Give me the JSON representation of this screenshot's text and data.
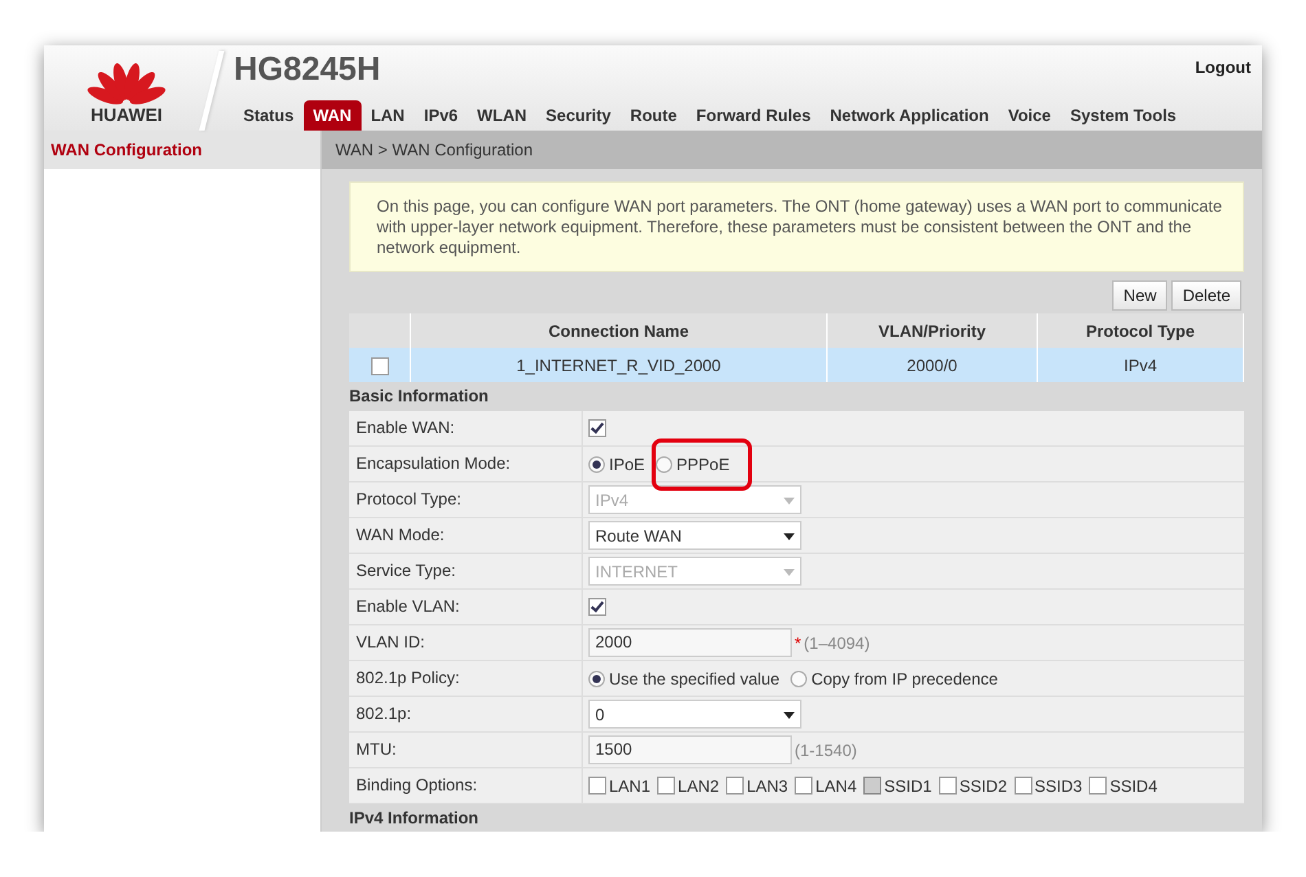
{
  "header": {
    "logo_text": "HUAWEI",
    "model": "HG8245H",
    "logout": "Logout",
    "nav": [
      {
        "label": "Status",
        "selected": false
      },
      {
        "label": "WAN",
        "selected": true
      },
      {
        "label": "LAN",
        "selected": false
      },
      {
        "label": "IPv6",
        "selected": false
      },
      {
        "label": "WLAN",
        "selected": false
      },
      {
        "label": "Security",
        "selected": false
      },
      {
        "label": "Route",
        "selected": false
      },
      {
        "label": "Forward Rules",
        "selected": false
      },
      {
        "label": "Network Application",
        "selected": false
      },
      {
        "label": "Voice",
        "selected": false
      },
      {
        "label": "System Tools",
        "selected": false
      }
    ]
  },
  "sidebar": {
    "items": [
      {
        "label": "WAN Configuration",
        "selected": true
      }
    ]
  },
  "breadcrumb": "WAN > WAN Configuration",
  "notice": "On this page, you can configure WAN port parameters. The ONT (home gateway) uses a WAN port to communicate with upper-layer network equipment. Therefore, these parameters must be consistent between the ONT and the network equipment.",
  "buttons": [
    "New",
    "Delete"
  ],
  "table": {
    "columns": [
      "Connection Name",
      "VLAN/Priority",
      "Protocol Type"
    ],
    "rows": [
      {
        "checked": false,
        "selected": true,
        "cells": [
          "1_INTERNET_R_VID_2000",
          "2000/0",
          "IPv4"
        ]
      }
    ]
  },
  "sections": [
    {
      "title": "Basic Information",
      "fields": [
        {
          "label": "Enable WAN:",
          "kind": "checkbox",
          "checked": true
        },
        {
          "label": "Encapsulation Mode:",
          "kind": "radio",
          "options": [
            {
              "label": "IPoE",
              "selected": true,
              "highlighted": false
            },
            {
              "label": "PPPoE",
              "selected": false,
              "highlighted": true
            }
          ]
        },
        {
          "label": "Protocol Type:",
          "kind": "select",
          "value": "IPv4",
          "disabled": true
        },
        {
          "label": "WAN Mode:",
          "kind": "select",
          "value": "Route WAN",
          "disabled": false
        },
        {
          "label": "Service Type:",
          "kind": "select",
          "value": "INTERNET",
          "disabled": true
        },
        {
          "label": "Enable VLAN:",
          "kind": "checkbox",
          "checked": true
        },
        {
          "label": "VLAN ID:",
          "kind": "text",
          "value": "2000",
          "required_mark": "*",
          "hint": "(1–4094)"
        },
        {
          "label": "802.1p Policy:",
          "kind": "radio",
          "options": [
            {
              "label": "Use the specified value",
              "selected": true,
              "highlighted": false
            },
            {
              "label": "Copy from IP precedence",
              "selected": false,
              "highlighted": false
            }
          ]
        },
        {
          "label": "802.1p:",
          "kind": "select",
          "value": "0",
          "disabled": false
        },
        {
          "label": "MTU:",
          "kind": "text",
          "value": "1500",
          "hint": "(1-1540)"
        },
        {
          "label": "Binding Options:",
          "kind": "checklist",
          "options": [
            {
              "label": "LAN1",
              "checked": false,
              "disabled": false
            },
            {
              "label": "LAN2",
              "checked": false,
              "disabled": false
            },
            {
              "label": "LAN3",
              "checked": false,
              "disabled": false
            },
            {
              "label": "LAN4",
              "checked": false,
              "disabled": false
            },
            {
              "label": "SSID1",
              "checked": false,
              "disabled": true
            },
            {
              "label": "SSID2",
              "checked": false,
              "disabled": false
            },
            {
              "label": "SSID3",
              "checked": false,
              "disabled": false
            },
            {
              "label": "SSID4",
              "checked": false,
              "disabled": false
            }
          ]
        }
      ]
    },
    {
      "title": "IPv4 Information"
    }
  ]
}
